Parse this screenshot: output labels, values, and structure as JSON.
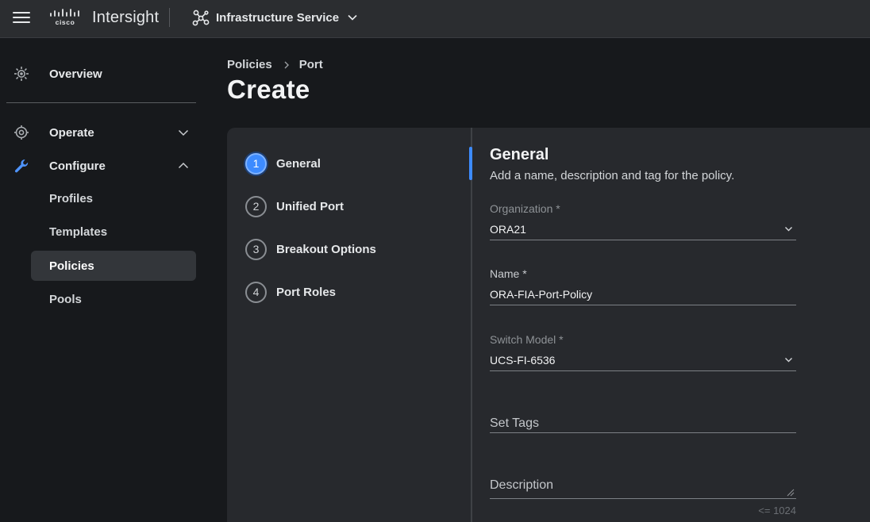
{
  "header": {
    "brand": "Intersight",
    "service_label": "Infrastructure Service"
  },
  "sidebar": {
    "items": [
      {
        "label": "Overview"
      },
      {
        "label": "Operate"
      },
      {
        "label": "Configure"
      }
    ],
    "configure_children": [
      {
        "label": "Profiles"
      },
      {
        "label": "Templates"
      },
      {
        "label": "Policies",
        "active": true
      },
      {
        "label": "Pools"
      }
    ]
  },
  "breadcrumb": {
    "items": [
      "Policies",
      "Port"
    ]
  },
  "page": {
    "title": "Create"
  },
  "wizard": {
    "steps": [
      {
        "number": "1",
        "label": "General",
        "active": true
      },
      {
        "number": "2",
        "label": "Unified Port"
      },
      {
        "number": "3",
        "label": "Breakout Options"
      },
      {
        "number": "4",
        "label": "Port Roles"
      }
    ],
    "form": {
      "title": "General",
      "description": "Add a name, description and tag for the policy.",
      "organization": {
        "label": "Organization *",
        "value": "ORA21"
      },
      "name": {
        "label": "Name *",
        "value": "ORA-FIA-Port-Policy"
      },
      "switch_model": {
        "label": "Switch Model *",
        "value": "UCS-FI-6536"
      },
      "tags": {
        "placeholder": "Set Tags"
      },
      "description_field": {
        "placeholder": "Description",
        "limit": "<= 1024"
      }
    }
  },
  "colors": {
    "accent": "#3d8bff",
    "background": "#17191c",
    "panel": "#27292d",
    "topbar": "#2b2d30"
  }
}
